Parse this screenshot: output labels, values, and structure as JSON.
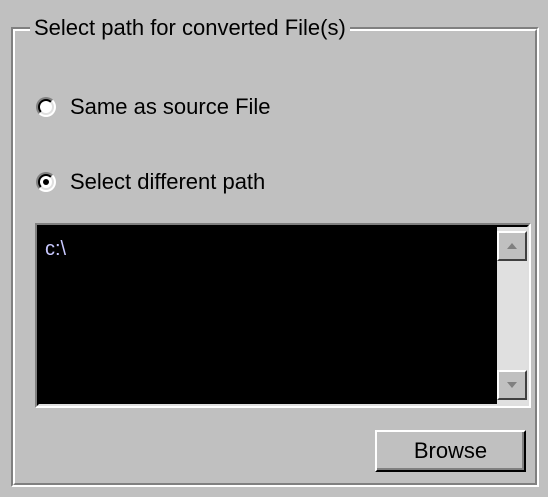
{
  "group": {
    "title": "Select path for converted File(s)"
  },
  "options": [
    {
      "label": "Same as source File",
      "selected": false
    },
    {
      "label": "Select different path",
      "selected": true
    }
  ],
  "path_field": {
    "value": "c:\\",
    "text_color": "#c8c8ff",
    "background": "#000000"
  },
  "scrollbar": {
    "up_icon": "arrow-up-icon",
    "down_icon": "arrow-down-icon"
  },
  "buttons": {
    "browse_label": "Browse"
  },
  "colors": {
    "window_bg": "#c0c0c0"
  }
}
